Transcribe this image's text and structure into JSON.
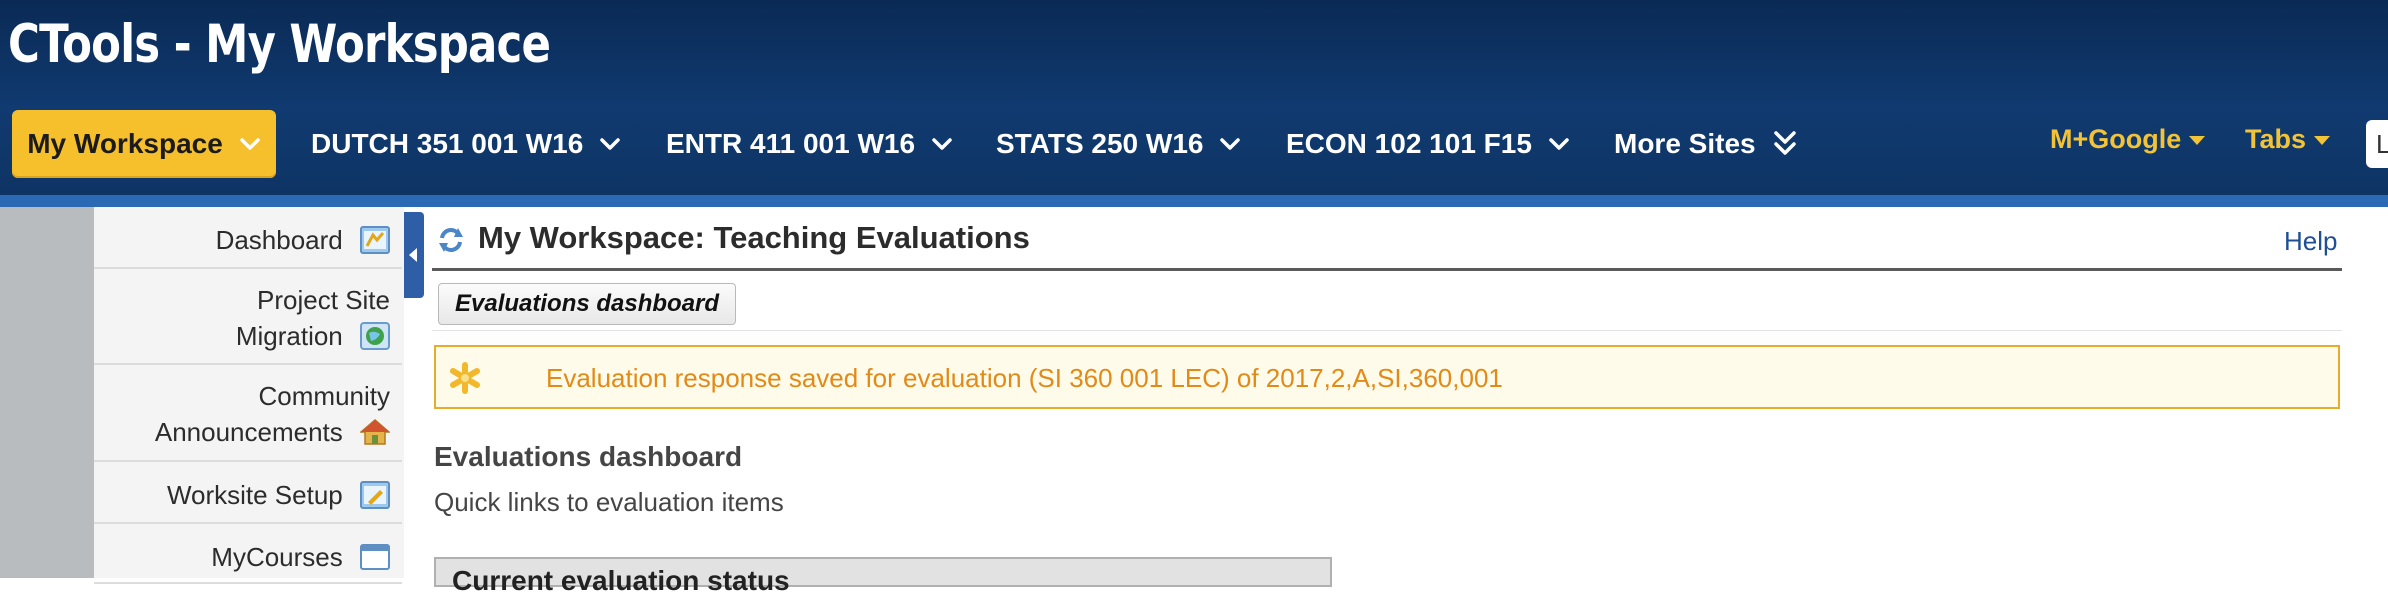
{
  "app": {
    "title": "CTools - My Workspace"
  },
  "site_nav": {
    "tabs": [
      {
        "label": "My Workspace",
        "active": true
      },
      {
        "label": "DUTCH 351 001 W16"
      },
      {
        "label": "ENTR 411 001 W16"
      },
      {
        "label": "STATS 250 W16"
      },
      {
        "label": "ECON 102 101 F15"
      },
      {
        "label": "More Sites"
      }
    ],
    "right_links": [
      {
        "label": "M+Google"
      },
      {
        "label": "Tabs"
      }
    ],
    "login_partial": "L"
  },
  "tool_nav": {
    "items": [
      {
        "label": "Dashboard",
        "icon": "dashboard-icon"
      },
      {
        "label_line1": "Project Site",
        "label_line2": "Migration",
        "icon": "globe-icon"
      },
      {
        "label_line1": "Community",
        "label_line2": "Announcements",
        "icon": "home-icon"
      },
      {
        "label": "Worksite Setup",
        "icon": "worksite-setup-icon"
      },
      {
        "label": "MyCourses",
        "icon": "window-icon"
      }
    ]
  },
  "main": {
    "title": "My Workspace: Teaching Evaluations",
    "help": "Help",
    "sub_nav_button": "Evaluations dashboard",
    "alert": "Evaluation response saved for evaluation (SI 360 001 LEC) of 2017,2,A,SI,360,001",
    "section_heading": "Evaluations dashboard",
    "section_sub": "Quick links to evaluation items",
    "table_header": "Current evaluation status"
  },
  "colors": {
    "header_bg": "#0e3464",
    "active_tab": "#f5c02c",
    "accent_yellow": "#f3c337",
    "alert_text": "#e28a17",
    "alert_border": "#e6ad2a"
  }
}
